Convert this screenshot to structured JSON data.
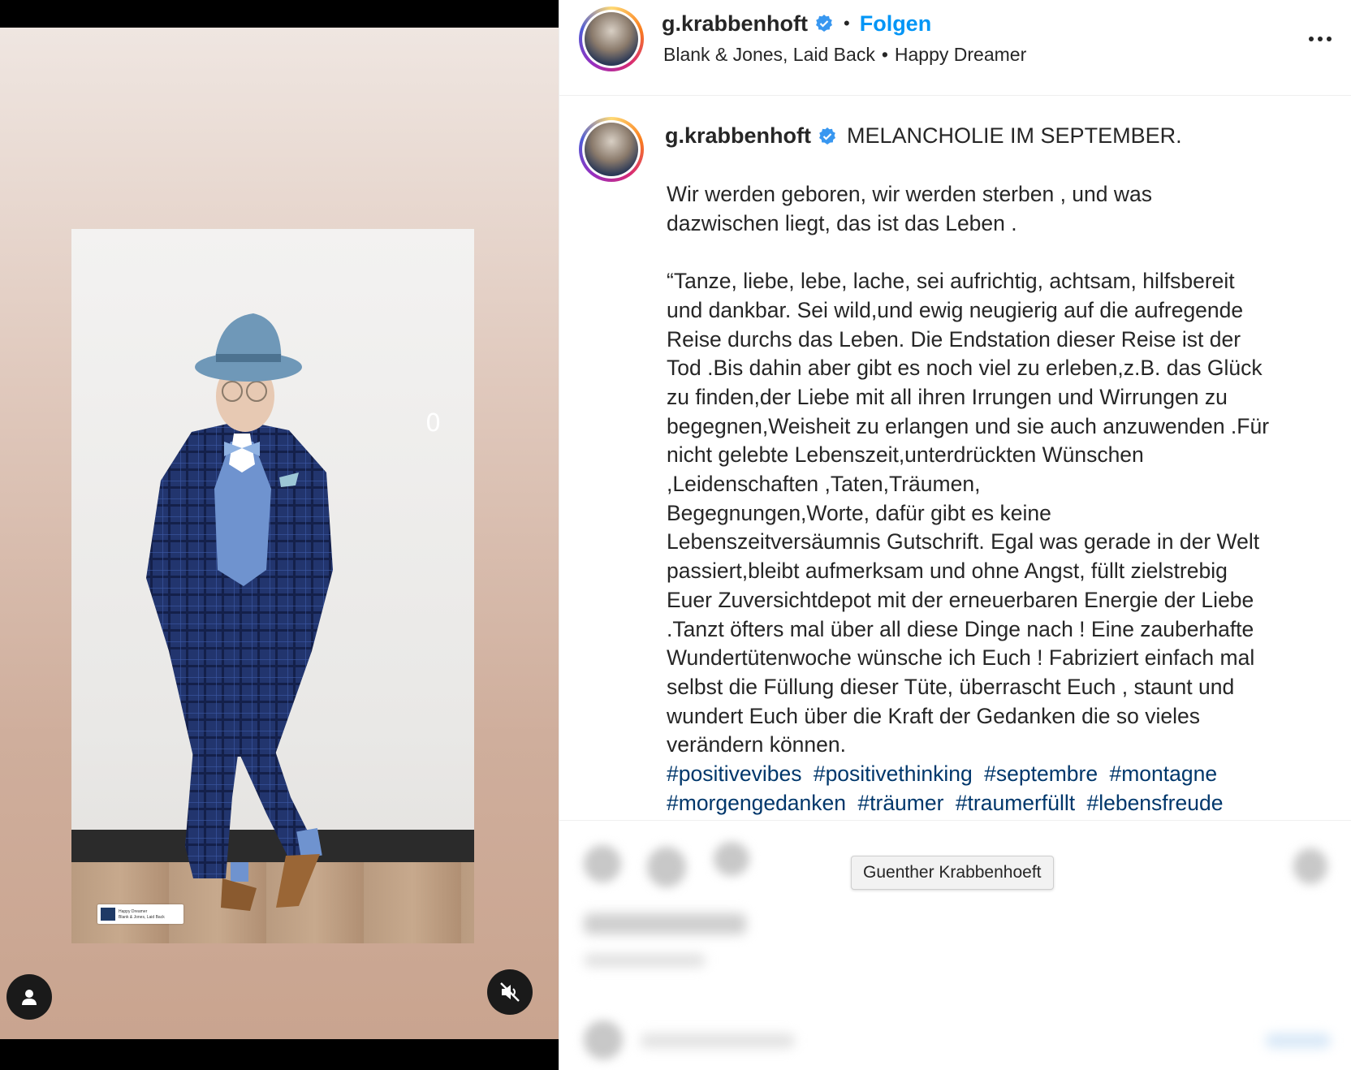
{
  "header": {
    "username": "g.krabbenhoft",
    "separator": "•",
    "follow_label": "Folgen",
    "audio_artist": "Blank & Jones, Laid Back",
    "audio_separator": "•",
    "audio_title": "Happy Dreamer"
  },
  "caption": {
    "username": "g.krabbenhoft",
    "title": "MELANCHOLIE IM SEPTEMBER.",
    "body": "Wir werden geboren, wir werden sterben , und was\ndazwischen liegt, das ist das Leben .\n\n“Tanze, liebe, lebe, lache, sei aufrichtig, achtsam, hilfsbereit\nund dankbar. Sei wild,und ewig neugierig auf die aufregende\nReise durchs das Leben. Die Endstation dieser Reise ist der\nTod .Bis dahin aber gibt es noch viel zu erleben,z.B. das Glück\nzu finden,der Liebe mit all ihren Irrungen und Wirrungen zu\nbegegnen,Weisheit zu erlangen und sie auch anzuwenden .Für\nnicht gelebte Lebenszeit,unterdrückten Wünschen\n,Leidenschaften ,Taten,Träumen,\nBegegnungen,Worte, dafür gibt es keine\nLebenszeitversäumnis Gutschrift. Egal was gerade in der Welt\npassiert,bleibt aufmerksam und ohne Angst, füllt zielstrebig\nEuer Zuversichtdepot mit der erneuerbaren Energie der Liebe\n.Tanzt öfters mal über all diese Dinge nach ! Eine zauberhafte\nWundertütenwoche wünsche ich Euch ! Fabriziert einfach mal\nselbst die Füllung dieser Tüte, überrascht Euch , staunt und\nwundert Euch über die Kraft der Gedanken die so vieles\nverändern können.",
    "hashtags": [
      "#positivevibes",
      "#positivethinking",
      "#septembre",
      "#montagne",
      "#morgengedanken",
      "#träumer",
      "#traumerfüllt",
      "#lebensfreude"
    ]
  },
  "tooltip": {
    "text": "Guenther Krabbenhoeft"
  },
  "media": {
    "frame_mark": "0",
    "music_sticker_title": "Happy Dreamer",
    "music_sticker_artist": "Blank & Jones, Laid Back"
  },
  "icons": {
    "verified": "verified-badge-icon",
    "more": "more-options-icon",
    "user_tag": "user-tag-icon",
    "mute": "volume-muted-icon"
  },
  "colors": {
    "link_blue": "#0095f6",
    "hashtag_blue": "#00376b",
    "verified_blue": "#3897f0",
    "text": "#262626"
  }
}
